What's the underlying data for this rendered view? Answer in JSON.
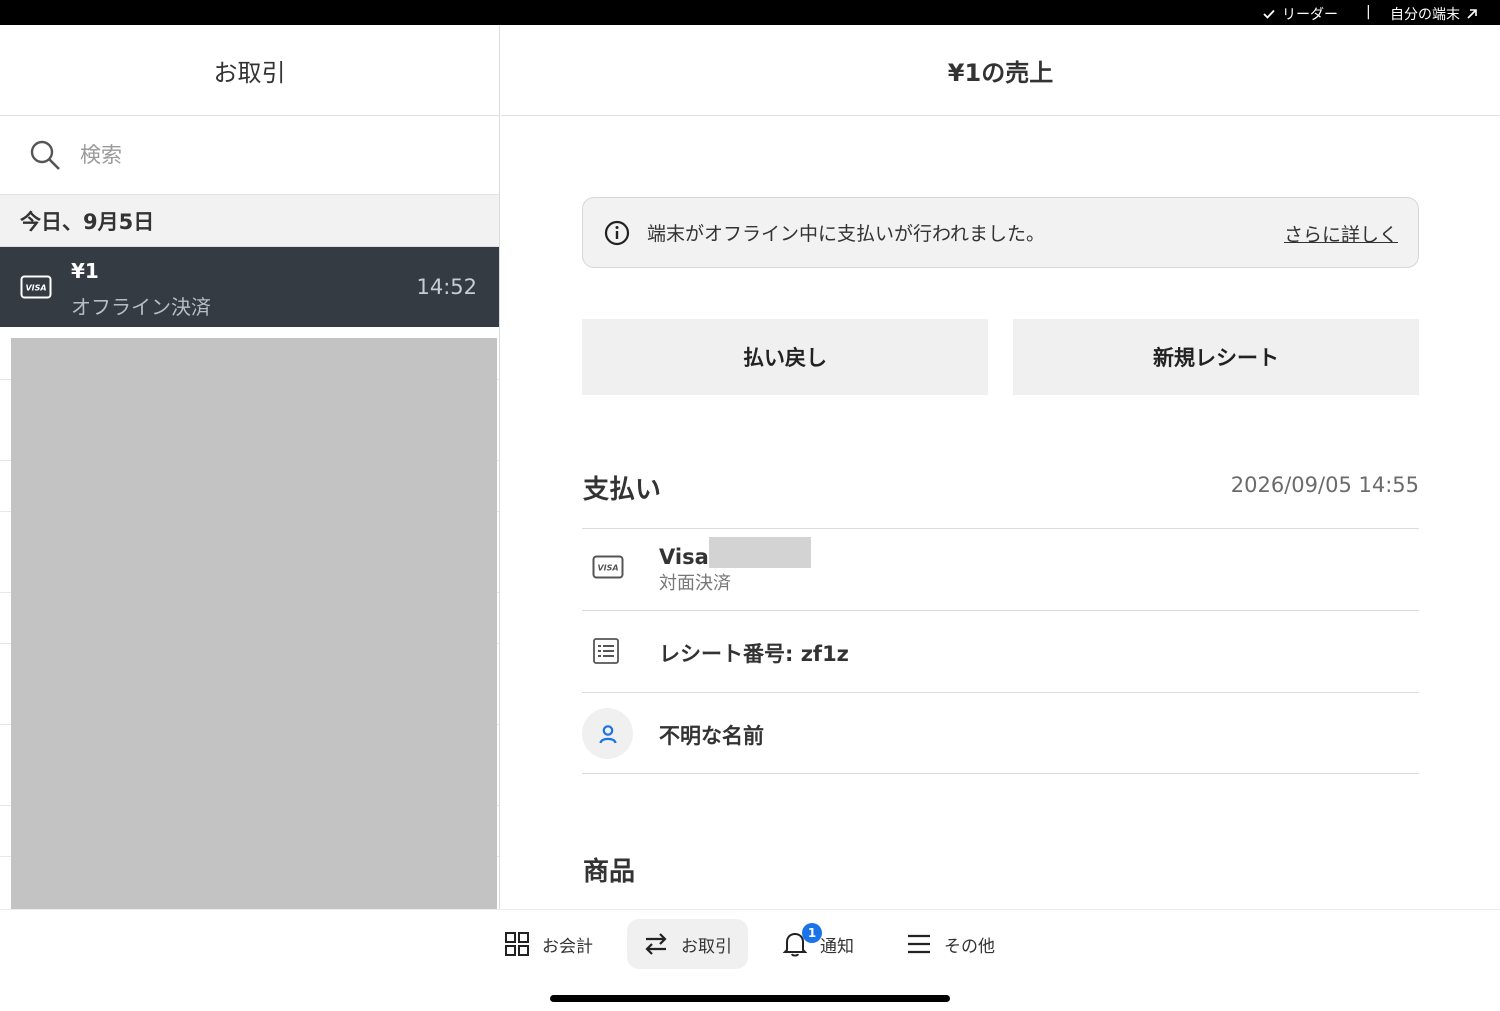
{
  "status_bar": {
    "reader_label": "リーダー",
    "separator": "|",
    "terminal_label": "自分の端末"
  },
  "left_pane": {
    "title": "お取引",
    "search": {
      "placeholder": "検索"
    },
    "date_header": "今日、9月5日",
    "transaction": {
      "amount": "¥1",
      "subtitle": "オフライン決済",
      "time": "14:52",
      "card_brand": "VISA"
    }
  },
  "right_pane": {
    "title": "¥1の売上",
    "banner": {
      "message": "端末がオフライン中に支払いが行われました。",
      "link": "さらに詳しく"
    },
    "buttons": {
      "refund": "払い戻し",
      "new_receipt": "新規レシート"
    },
    "payment": {
      "title": "支払い",
      "date": "2026/09/05 14:55",
      "card": {
        "brand": "Visa",
        "method": "対面決済",
        "icon_label": "VISA"
      },
      "receipt": "レシート番号: zf1z",
      "customer": "不明な名前"
    },
    "items_title": "商品"
  },
  "bottom_nav": {
    "items": [
      {
        "label": "お会計",
        "icon": "grid-icon"
      },
      {
        "label": "お取引",
        "icon": "swap-arrows-icon",
        "active": true
      },
      {
        "label": "通知",
        "icon": "bell-icon",
        "badge": "1"
      },
      {
        "label": "その他",
        "icon": "menu-icon"
      }
    ]
  },
  "colors": {
    "selected_row": "#353b43",
    "badge": "#1a73e8",
    "avatar_icon": "#1a73e8"
  }
}
